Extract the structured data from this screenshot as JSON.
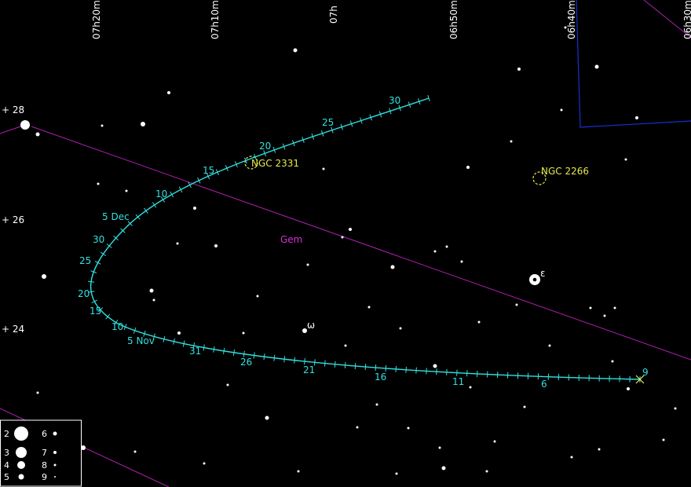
{
  "chart": {
    "ra_labels": [
      "07h20m",
      "07h10m",
      "07h",
      "06h50m",
      "06h40m",
      "06h30m"
    ],
    "dec_labels": [
      "+ 28",
      "+ 26",
      "+ 24"
    ],
    "constellation": "Gem",
    "objects": [
      {
        "name": "NGC 2331"
      },
      {
        "name": "NGC 2266"
      }
    ],
    "star_labels": [
      "ε",
      "ω"
    ],
    "path_labels": [
      "30",
      "25",
      "20",
      "15",
      "10",
      "5 Dec",
      "30",
      "25",
      "20",
      "15",
      "10",
      "5 Nov",
      "31",
      "26",
      "21",
      "16",
      "11",
      "6",
      "9"
    ],
    "magnitude_legend": [
      "2",
      "3",
      "4",
      "5",
      "6",
      "7",
      "8",
      "9"
    ],
    "colors": {
      "background": "#000000",
      "comet_path": "#33e0e0",
      "ecliptic": "#b020b0",
      "boundary": "#1a2fd0",
      "dso": "#e8e84a",
      "constellation_label": "#d030d0",
      "stars": "#ffffff"
    }
  }
}
